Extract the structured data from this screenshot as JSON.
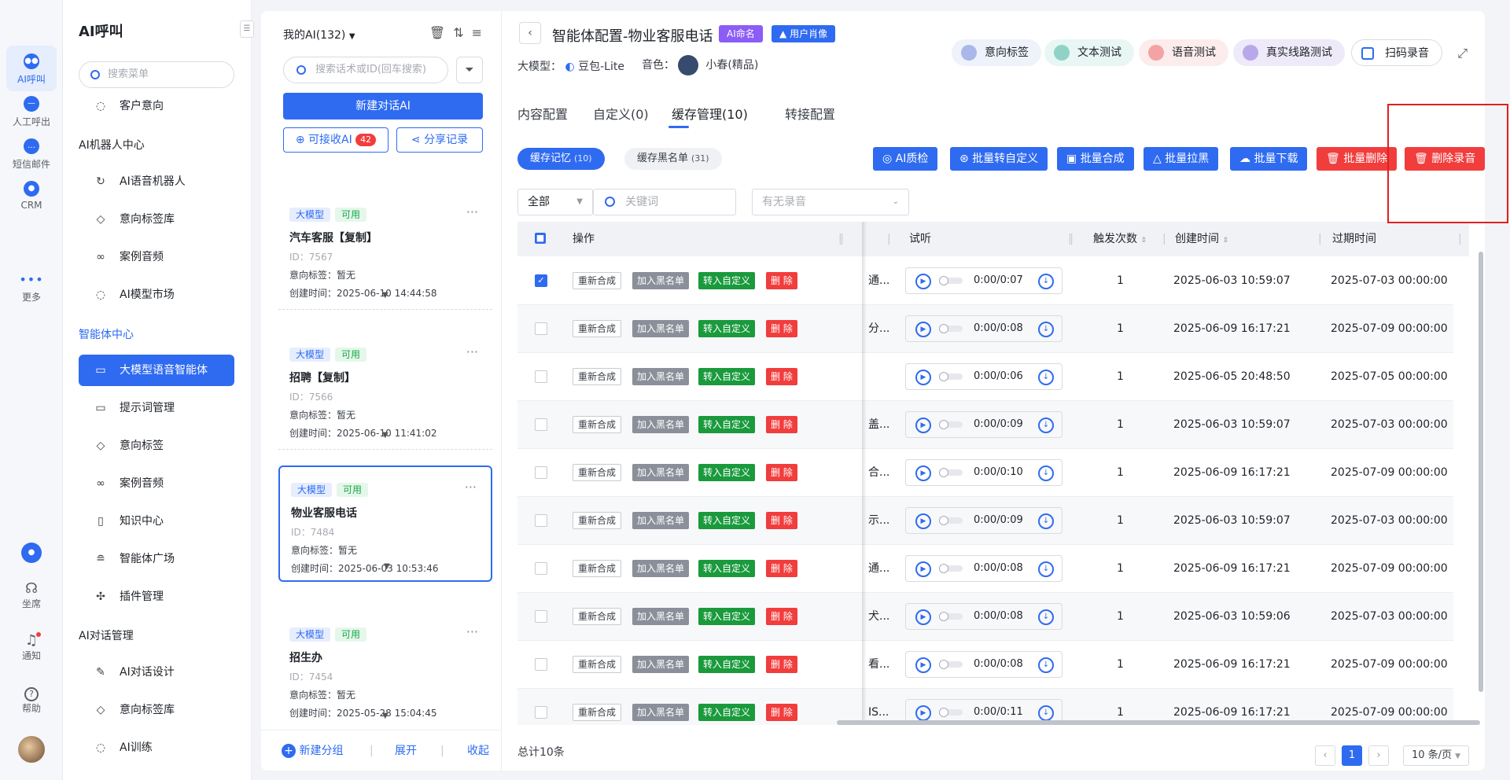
{
  "rail": {
    "items": [
      {
        "label": "AI呼叫",
        "active": true
      },
      {
        "label": "人工呼出",
        "active": false
      },
      {
        "label": "短信邮件",
        "active": false
      },
      {
        "label": "CRM",
        "active": false
      },
      {
        "label": "更多",
        "active": false
      }
    ],
    "bottom": {
      "seat": "坐席",
      "notify": "通知",
      "help": "帮助"
    }
  },
  "nav": {
    "title": "AI呼叫",
    "search_placeholder": "搜索菜单",
    "top_item": "客户意向",
    "groups": [
      {
        "title": "AI机器人中心",
        "items": [
          "AI语音机器人",
          "意向标签库",
          "案例音频",
          "AI模型市场"
        ]
      },
      {
        "title": "智能体中心",
        "items": [
          "大模型语音智能体",
          "提示词管理",
          "意向标签",
          "案例音频",
          "知识中心",
          "智能体广场",
          "插件管理"
        ]
      },
      {
        "title": "AI对话管理",
        "items": [
          "AI对话设计",
          "意向标签库",
          "AI训练"
        ]
      }
    ],
    "active_item": "大模型语音智能体"
  },
  "list": {
    "header": "我的AI(132)",
    "search_placeholder": "搜索话术或ID(回车搜索)",
    "new_button": "新建对话AI",
    "receivable_label": "可接收AI",
    "receivable_count": "42",
    "share_label": "分享记录",
    "tag_model": "大模型",
    "tag_available": "可用",
    "label_intent": "意向标签：",
    "label_created": "创建时间：",
    "cards": [
      {
        "title": "汽车客服【复制】",
        "id": "ID：7567",
        "intent": "暂无",
        "created": "2025-06-10 14:44:58"
      },
      {
        "title": "招聘【复制】",
        "id": "ID：7566",
        "intent": "暂无",
        "created": "2025-06-10 11:41:02"
      },
      {
        "title": "物业客服电话",
        "id": "ID：7484",
        "intent": "暂无",
        "created": "2025-06-03 10:53:46"
      },
      {
        "title": "招生办",
        "id": "ID：7454",
        "intent": "暂无",
        "created": "2025-05-28 15:04:45"
      }
    ],
    "footer": {
      "new_group": "新建分组",
      "expand": "展开",
      "collapse": "收起"
    }
  },
  "main": {
    "title": "智能体配置-物业客服电话",
    "pill_ai_name": "AI命名",
    "pill_portrait": "用户肖像",
    "model_label": "大模型：",
    "model_value": "豆包-Lite",
    "voice_label": "音色：",
    "voice_value": "小春(精品)",
    "tool_buttons": [
      "意向标签",
      "文本测试",
      "语音测试",
      "真实线路测试",
      "扫码录音"
    ],
    "tabs": [
      "内容配置",
      "自定义(0)",
      "缓存管理(10)",
      "转接配置"
    ],
    "active_tab": "缓存管理(10)",
    "seg_memory": "缓存记忆",
    "seg_memory_count": "(10)",
    "seg_black": "缓存黑名单",
    "seg_black_count": "(31)",
    "actions": [
      "AI质检",
      "批量转自定义",
      "批量合成",
      "批量拉黑",
      "批量下载",
      "批量删除",
      "删除录音"
    ],
    "filter_all": "全部",
    "filter_keyword_placeholder": "关键词",
    "filter_recording_placeholder": "有无录音",
    "columns": {
      "op": "操作",
      "listen": "试听",
      "count": "触发次数",
      "created": "创建时间",
      "expire": "过期时间"
    },
    "row_buttons": {
      "resynth": "重新合成",
      "blacklist": "加入黑名单",
      "to_custom": "转入自定义",
      "delete": "删 除"
    },
    "rows": [
      {
        "snippet": "通...",
        "time": "0:00/0:07",
        "count": "1",
        "created": "2025-06-03 10:59:07",
        "expire": "2025-07-03 00:00:00",
        "checked": true
      },
      {
        "snippet": "分...",
        "time": "0:00/0:08",
        "count": "1",
        "created": "2025-06-09 16:17:21",
        "expire": "2025-07-09 00:00:00",
        "checked": false
      },
      {
        "snippet": "",
        "time": "0:00/0:06",
        "count": "1",
        "created": "2025-06-05 20:48:50",
        "expire": "2025-07-05 00:00:00",
        "checked": false
      },
      {
        "snippet": "盖...",
        "time": "0:00/0:09",
        "count": "1",
        "created": "2025-06-03 10:59:07",
        "expire": "2025-07-03 00:00:00",
        "checked": false
      },
      {
        "snippet": "合...",
        "time": "0:00/0:10",
        "count": "1",
        "created": "2025-06-09 16:17:21",
        "expire": "2025-07-09 00:00:00",
        "checked": false
      },
      {
        "snippet": "示...",
        "time": "0:00/0:09",
        "count": "1",
        "created": "2025-06-03 10:59:07",
        "expire": "2025-07-03 00:00:00",
        "checked": false
      },
      {
        "snippet": "通...",
        "time": "0:00/0:08",
        "count": "1",
        "created": "2025-06-09 16:17:21",
        "expire": "2025-07-09 00:00:00",
        "checked": false
      },
      {
        "snippet": "犬...",
        "time": "0:00/0:08",
        "count": "1",
        "created": "2025-06-03 10:59:06",
        "expire": "2025-07-03 00:00:00",
        "checked": false
      },
      {
        "snippet": "看...",
        "time": "0:00/0:08",
        "count": "1",
        "created": "2025-06-09 16:17:21",
        "expire": "2025-07-09 00:00:00",
        "checked": false
      },
      {
        "snippet": "IS...",
        "time": "0:00/0:11",
        "count": "1",
        "created": "2025-06-09 16:17:21",
        "expire": "2025-07-09 00:00:00",
        "checked": false
      }
    ],
    "total": "总计10条",
    "page": "1",
    "page_size": "10 条/页"
  },
  "colors": {
    "primary": "#2f6bf1",
    "danger": "#f23d3d",
    "success": "#1a9a3c",
    "highlight_box": "#e02020"
  }
}
